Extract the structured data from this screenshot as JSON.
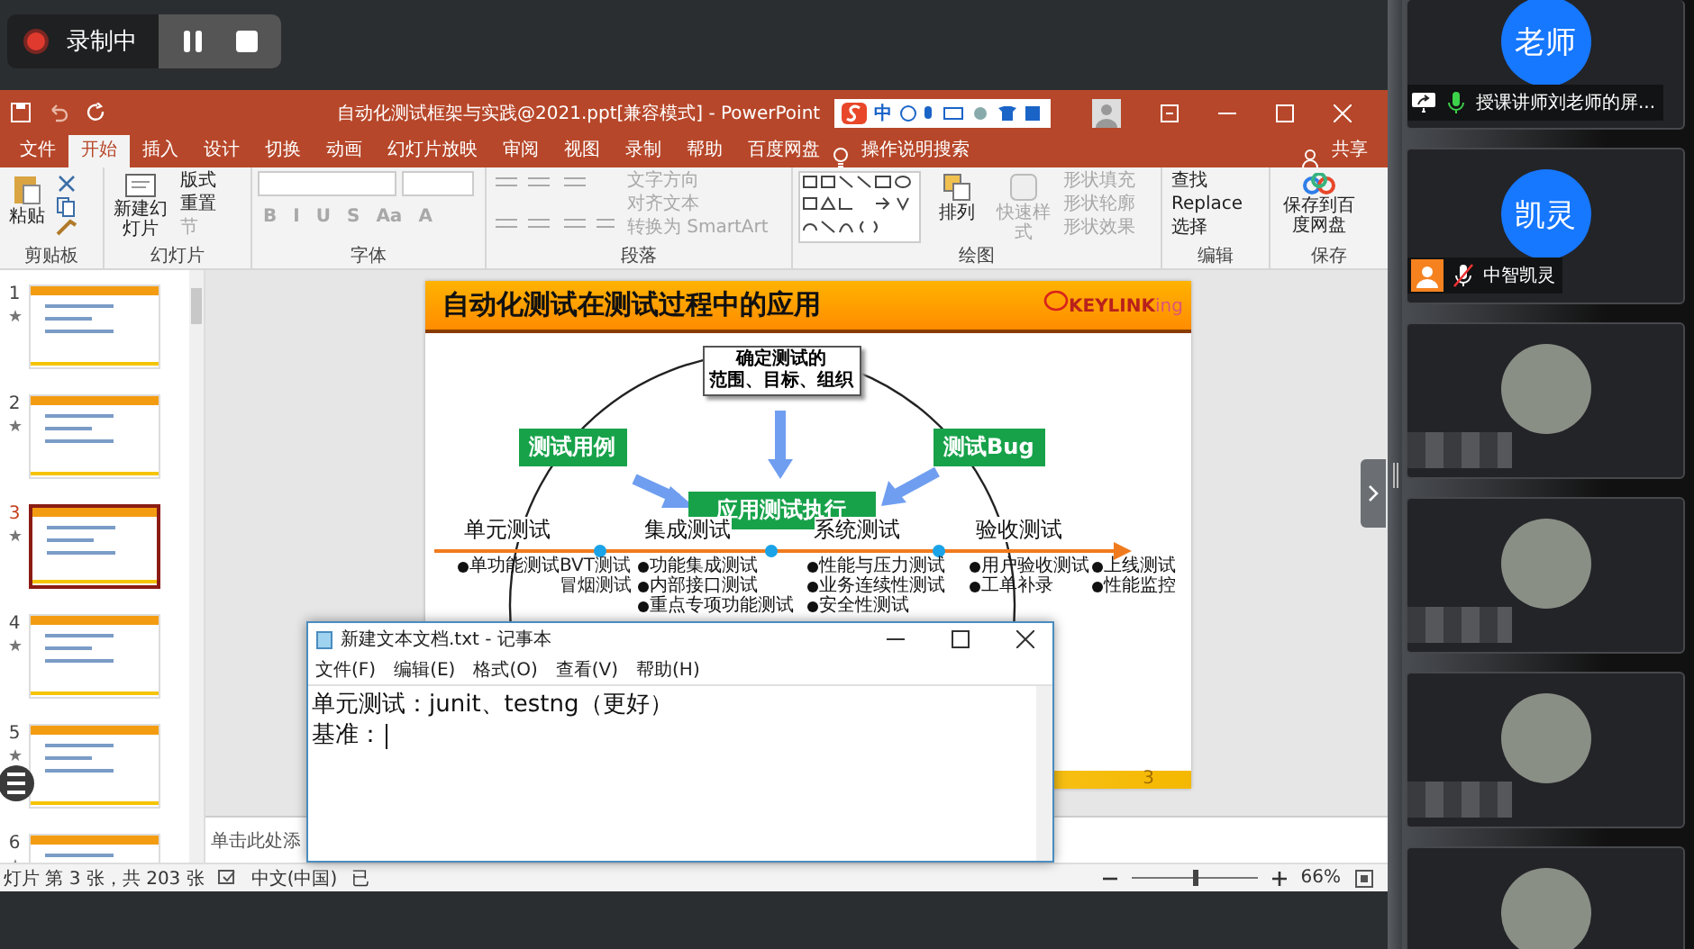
{
  "recorder": {
    "status": "录制中",
    "recording": true
  },
  "ppt": {
    "title": "自动化测试框架与实践@2021.ppt[兼容模式] - PowerPoint",
    "ime": "中",
    "tabs": [
      {
        "label": "文件",
        "selected": false
      },
      {
        "label": "开始",
        "selected": true
      },
      {
        "label": "插入",
        "selected": false
      },
      {
        "label": "设计",
        "selected": false
      },
      {
        "label": "切换",
        "selected": false
      },
      {
        "label": "动画",
        "selected": false
      },
      {
        "label": "幻灯片放映",
        "selected": false
      },
      {
        "label": "审阅",
        "selected": false
      },
      {
        "label": "视图",
        "selected": false
      },
      {
        "label": "录制",
        "selected": false
      },
      {
        "label": "帮助",
        "selected": false
      },
      {
        "label": "百度网盘",
        "selected": false
      }
    ],
    "search": "操作说明搜索",
    "share": "共享",
    "groups": [
      {
        "label": "剪贴板",
        "buttons": [
          {
            "label": "粘贴",
            "disabled": false
          }
        ]
      },
      {
        "label": "幻灯片",
        "buttons": [
          {
            "label": "新建幻灯片",
            "disabled": false
          },
          {
            "label": "版式",
            "disabled": false
          },
          {
            "label": "重置",
            "disabled": false
          },
          {
            "label": "节",
            "disabled": true
          }
        ]
      },
      {
        "label": "字体",
        "buttons": [
          {
            "label": "B",
            "disabled": true
          },
          {
            "label": "I",
            "disabled": true
          },
          {
            "label": "U",
            "disabled": true
          },
          {
            "label": "S",
            "disabled": true
          },
          {
            "label": "Aa",
            "disabled": true
          },
          {
            "label": "A",
            "disabled": true
          }
        ]
      },
      {
        "label": "段落",
        "buttons": [
          {
            "label": "文字方向",
            "disabled": true
          },
          {
            "label": "对齐文本",
            "disabled": true
          },
          {
            "label": "转换为 SmartArt",
            "disabled": true
          }
        ]
      },
      {
        "label": "绘图",
        "buttons": [
          {
            "label": "排列",
            "disabled": false
          },
          {
            "label": "快速样式",
            "disabled": true
          },
          {
            "label": "形状填充",
            "disabled": true
          },
          {
            "label": "形状轮廓",
            "disabled": true
          },
          {
            "label": "形状效果",
            "disabled": true
          }
        ]
      },
      {
        "label": "编辑",
        "buttons": [
          {
            "label": "查找",
            "disabled": false
          },
          {
            "label": "Replace",
            "disabled": false
          },
          {
            "label": "选择",
            "disabled": false
          }
        ]
      },
      {
        "label": "保存",
        "buttons": [
          {
            "label": "保存到百度网盘",
            "disabled": false
          }
        ]
      }
    ],
    "thumbnails": [
      {
        "number": "1",
        "selected": false
      },
      {
        "number": "2",
        "selected": false
      },
      {
        "number": "3",
        "selected": true
      },
      {
        "number": "4",
        "selected": false
      },
      {
        "number": "5",
        "selected": false
      },
      {
        "number": "6",
        "selected": false
      }
    ],
    "slide": {
      "title": "自动化测试在测试过程中的应用",
      "logo": "KEYLINK",
      "logo_sub": "ing",
      "scope": [
        "确定测试的",
        "范围、目标、组织"
      ],
      "left_tag": "测试用例",
      "right_tag": "测试Bug",
      "center": "应用测试执行",
      "stages": [
        {
          "name": "单元测试",
          "items": [
            "单功能测试"
          ]
        },
        {
          "name": "集成测试",
          "items": [
            "功能集成测试",
            "内部接口测试",
            "重点专项功能测试"
          ]
        },
        {
          "name": "系统测试",
          "items": [
            "性能与压力测试",
            "业务连续性测试",
            "安全性测试"
          ]
        },
        {
          "name": "验收测试",
          "items": [
            "用户验收测试",
            "工单补录"
          ]
        }
      ],
      "after_items": [
        "上线测试",
        "性能监控"
      ],
      "gate_labels": [
        "BVT测试",
        "冒烟测试"
      ],
      "page_number": "3"
    },
    "notes": "单击此处添",
    "status": {
      "slide_info": "灯片 第 3 张，共 203 张",
      "language": "中文(中国)",
      "extra": "已",
      "zoom": "66%",
      "zoom_slider": {
        "level": 0.5
      }
    }
  },
  "notepad": {
    "title": "新建文本文档.txt - 记事本",
    "menu": [
      "文件(F)",
      "编辑(E)",
      "格式(O)",
      "查看(V)",
      "帮助(H)"
    ],
    "lines": [
      "单元测试：junit、testng（更好）",
      "基准："
    ]
  },
  "participants": [
    {
      "kind": "text",
      "avatar": "老师",
      "name": "授课讲师刘老师的屏...",
      "sharing": true,
      "muted": false
    },
    {
      "kind": "text",
      "avatar": "凯灵",
      "name": "中智凯灵",
      "sharing": false,
      "muted": true
    },
    {
      "kind": "photo"
    },
    {
      "kind": "photo"
    },
    {
      "kind": "photo"
    },
    {
      "kind": "photo"
    }
  ]
}
